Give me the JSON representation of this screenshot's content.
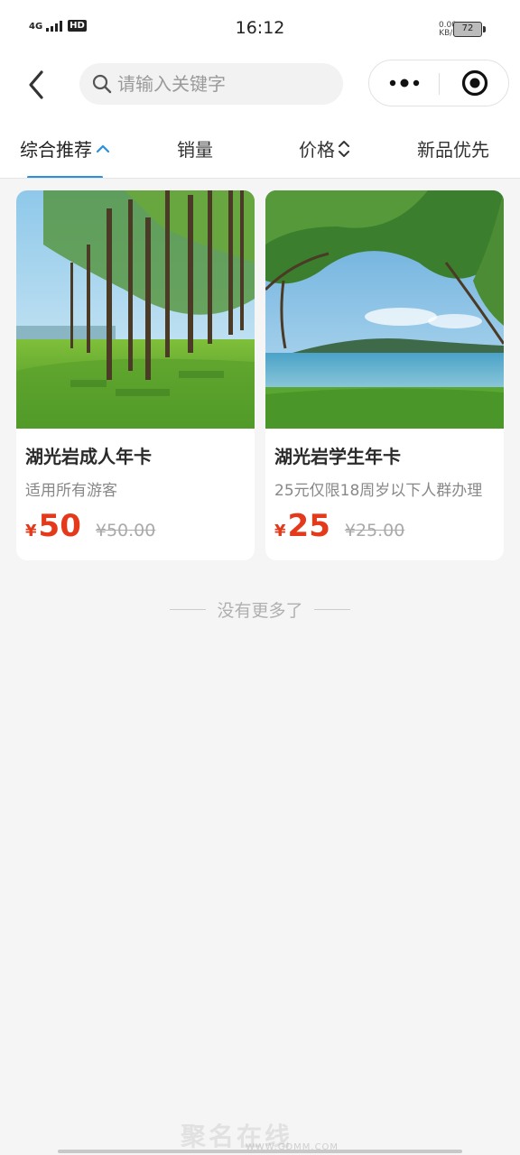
{
  "status_bar": {
    "network": "4G",
    "hd": "HD",
    "time": "16:12",
    "speed_value": "0.00",
    "speed_unit": "KB/s",
    "battery": "72"
  },
  "search": {
    "placeholder": "请输入关键字"
  },
  "tabs": [
    {
      "label": "综合推荐",
      "active": true
    },
    {
      "label": "销量"
    },
    {
      "label": "价格"
    },
    {
      "label": "新品优先"
    }
  ],
  "products": [
    {
      "title": "湖光岩成人年卡",
      "desc": "适用所有游客",
      "currency": "¥",
      "price": "50",
      "original_price": "¥50.00"
    },
    {
      "title": "湖光岩学生年卡",
      "desc": "25元仅限18周岁以下人群办理",
      "currency": "¥",
      "price": "25",
      "original_price": "¥25.00"
    }
  ],
  "no_more": "没有更多了",
  "watermark": {
    "text": "聚名在线",
    "url": "WWW.GDMM.COM"
  },
  "colors": {
    "accent": "#2a8fde",
    "price": "#e4391b",
    "background": "#f5f5f5"
  }
}
